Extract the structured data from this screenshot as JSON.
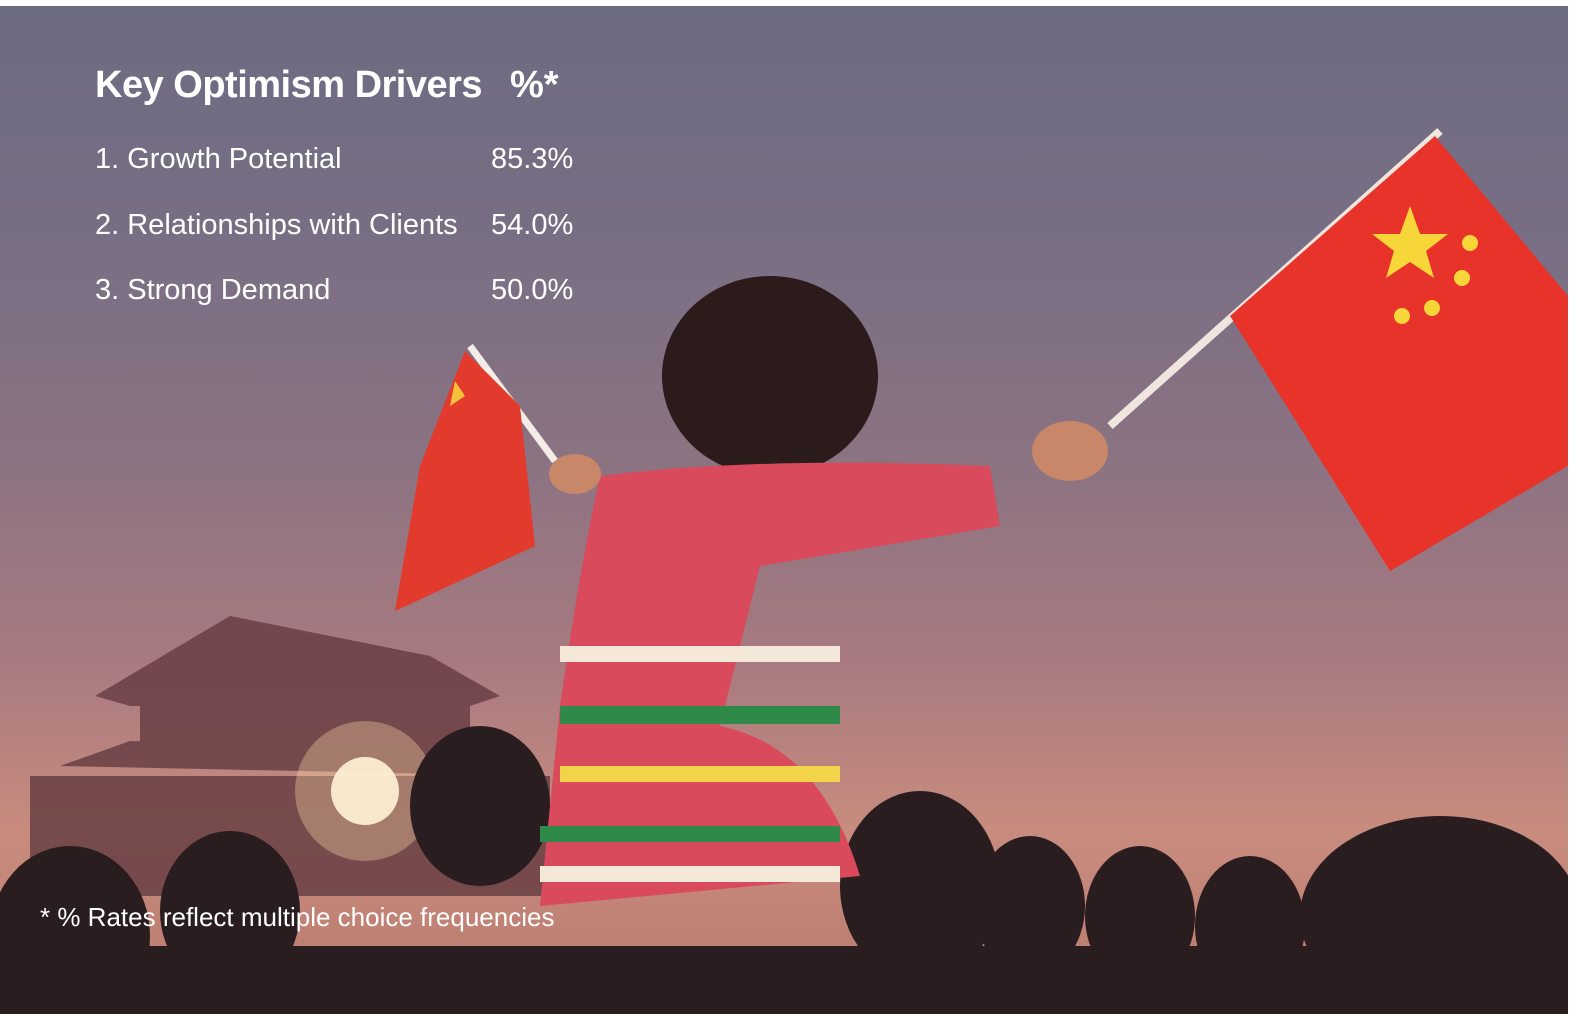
{
  "table": {
    "title": "Key Optimism Drivers",
    "value_header": "%*",
    "rows": [
      {
        "label": "1. Growth Potential",
        "value": "85.3%"
      },
      {
        "label": "2. Relationships with Clients",
        "value": "54.0%"
      },
      {
        "label": "3. Strong Demand",
        "value": "50.0%"
      }
    ]
  },
  "footnote": "* % Rates reflect multiple choice frequencies",
  "colors": {
    "text": "#ffffff",
    "flag_red": "#e8332a",
    "flag_star": "#f7d63a"
  }
}
